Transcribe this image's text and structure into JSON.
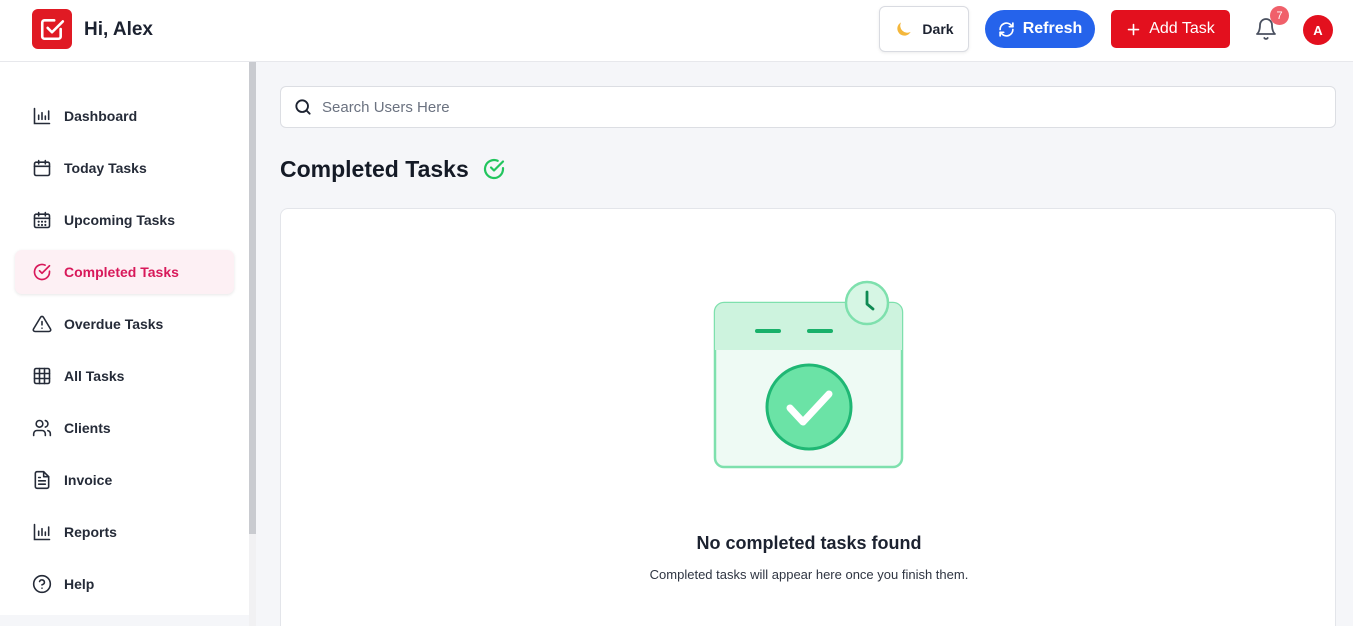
{
  "header": {
    "greeting": "Hi, Alex",
    "theme_button": "Dark",
    "refresh_button": "Refresh",
    "add_task_button": "Add Task",
    "notification_count": "7",
    "avatar_initial": "A"
  },
  "sidebar": {
    "items": [
      {
        "label": "Dashboard",
        "icon": "bar-chart-icon"
      },
      {
        "label": "Today Tasks",
        "icon": "calendar-icon"
      },
      {
        "label": "Upcoming Tasks",
        "icon": "calendar-days-icon"
      },
      {
        "label": "Completed Tasks",
        "icon": "check-circle-icon",
        "active": true
      },
      {
        "label": "Overdue Tasks",
        "icon": "warning-icon"
      },
      {
        "label": "All Tasks",
        "icon": "grid-icon"
      },
      {
        "label": "Clients",
        "icon": "users-icon"
      },
      {
        "label": "Invoice",
        "icon": "document-icon"
      },
      {
        "label": "Reports",
        "icon": "bar-chart-icon"
      },
      {
        "label": "Help",
        "icon": "help-circle-icon"
      }
    ]
  },
  "search": {
    "placeholder": "Search Users Here"
  },
  "main": {
    "title": "Completed Tasks",
    "empty_title": "No completed tasks found",
    "empty_subtitle": "Completed tasks will appear here once you finish them."
  },
  "colors": {
    "brand_red": "#e3101e",
    "refresh_blue": "#2563eb",
    "active_pink": "#d8195a",
    "success_green": "#22c55e"
  }
}
